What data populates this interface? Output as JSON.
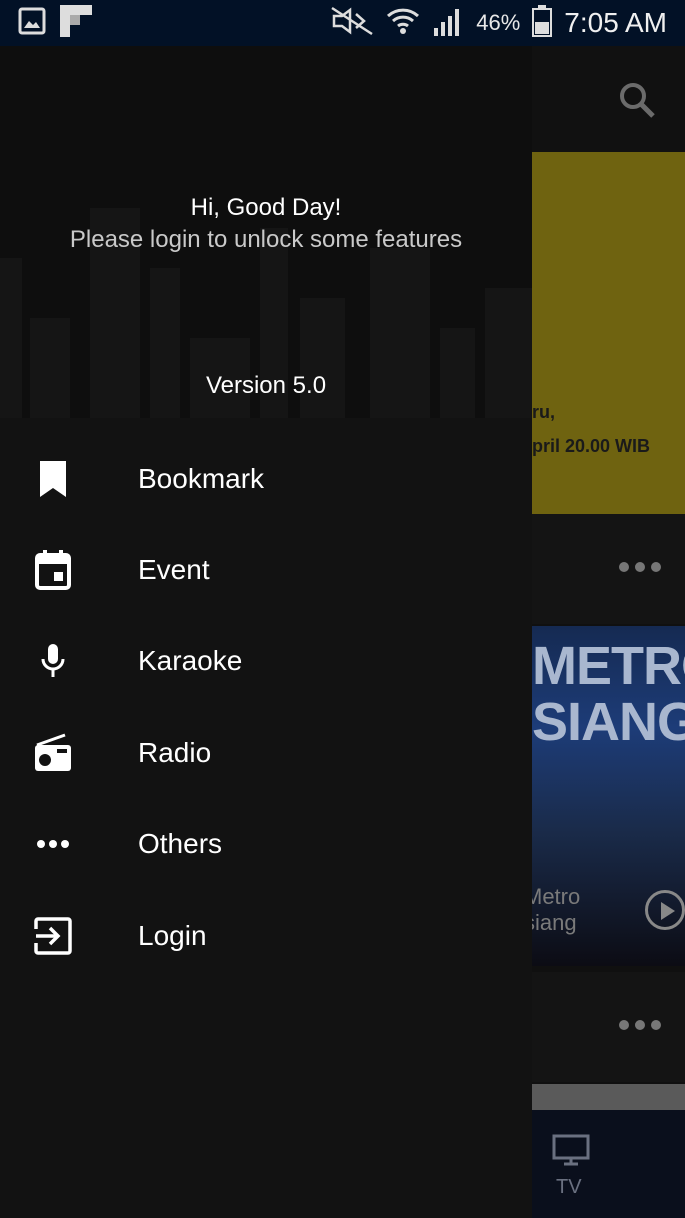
{
  "status_bar": {
    "battery": "46%",
    "time": "7:05 AM"
  },
  "drawer": {
    "greeting": "Hi, Good Day!",
    "login_hint": "Please login to unlock some features",
    "version": "Version 5.0",
    "menu": [
      {
        "label": "Bookmark",
        "icon": "bookmark-icon"
      },
      {
        "label": "Event",
        "icon": "calendar-icon"
      },
      {
        "label": "Karaoke",
        "icon": "microphone-icon"
      },
      {
        "label": "Radio",
        "icon": "radio-icon"
      },
      {
        "label": "Others",
        "icon": "more-horizontal-icon"
      },
      {
        "label": "Login",
        "icon": "login-icon"
      }
    ]
  },
  "background": {
    "banner_line1": "ru,",
    "banner_line2": "pril 20.00 WIB",
    "thumb_title": "METRO SIANG",
    "thumb_caption_line1": "Metro",
    "thumb_caption_line2": "siang",
    "bottom_nav_tv": "TV"
  },
  "colors": {
    "status_bar": "#021126",
    "drawer_bg": "#121212",
    "banner_yellow": "#6f6310"
  }
}
